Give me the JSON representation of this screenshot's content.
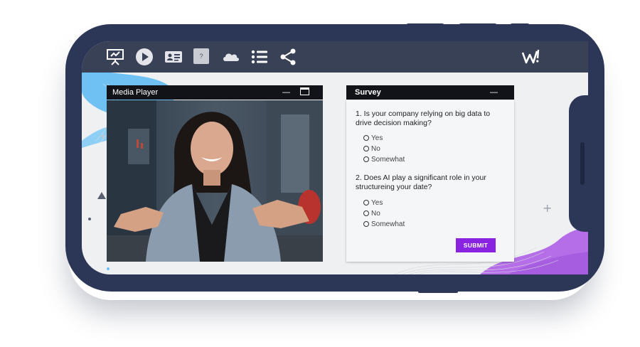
{
  "toolbar": {
    "icons": [
      "presentation-icon",
      "play-icon",
      "contact-card-icon",
      "help-icon",
      "cloud-icon",
      "list-icon",
      "share-icon"
    ],
    "help_label": "?",
    "logo_icon": "brand-logo-icon"
  },
  "media_player": {
    "title": "Media Player",
    "minimize_label": "—"
  },
  "survey": {
    "title": "Survey",
    "minimize_label": "—",
    "questions": [
      {
        "text": "1. Is your company relying on big data to drive decision making?",
        "options": [
          "Yes",
          "No",
          "Somewhat"
        ]
      },
      {
        "text": "2. Does AI play a significant role in your structureing your date?",
        "options": [
          "Yes",
          "No",
          "Somewhat"
        ]
      }
    ],
    "submit_label": "SUBMIT"
  },
  "colors": {
    "phone_frame": "#2c3657",
    "toolbar_bg": "#394156",
    "panel_header": "#111318",
    "submit_button": "#8a22e2",
    "accent_blue": "#6ec1f2",
    "accent_purple": "#b56ee8"
  }
}
